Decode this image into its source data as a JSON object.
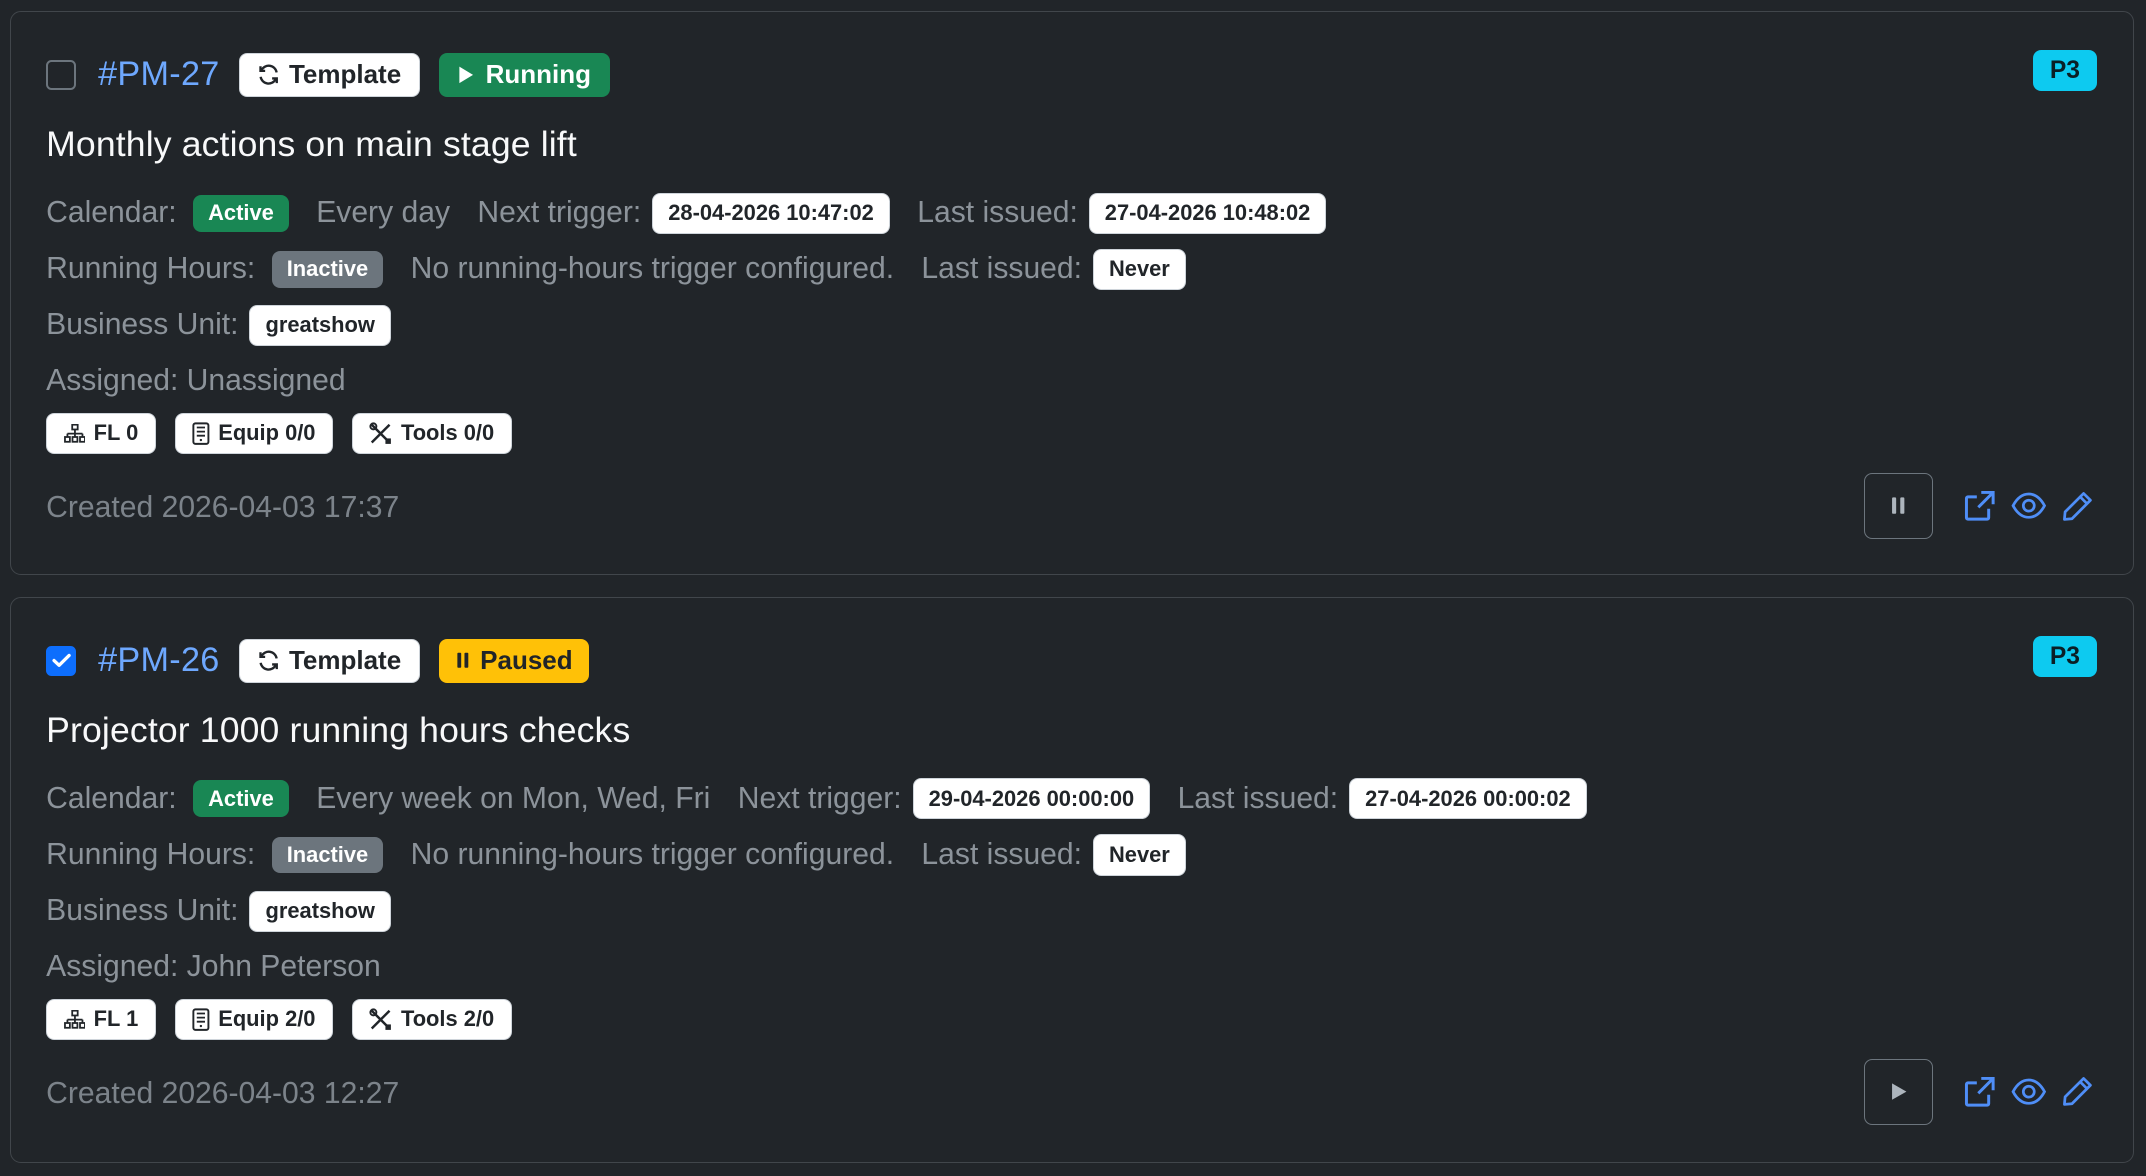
{
  "cards": [
    {
      "id": "#PM-27",
      "checked": false,
      "template_label": "Template",
      "status": "Running",
      "priority": "P3",
      "title": "Monthly actions on main stage lift",
      "calendar_label": "Calendar:",
      "calendar_state": "Active",
      "schedule": "Every day",
      "next_trigger_label": "Next trigger:",
      "next_trigger": "28-04-2026 10:47:02",
      "last_issued_label": "Last issued:",
      "last_issued": "27-04-2026 10:48:02",
      "running_hours_label": "Running Hours:",
      "running_hours_state": "Inactive",
      "running_hours_note": "No running-hours trigger configured.",
      "rh_last_issued_label": "Last issued:",
      "rh_last_issued": "Never",
      "business_unit_label": "Business Unit:",
      "business_unit": "greatshow",
      "assigned": "Assigned: Unassigned",
      "chip_fl": "FL 0",
      "chip_equip": "Equip 0/0",
      "chip_tools": "Tools 0/0",
      "created": "Created 2026-04-03 17:37",
      "toggle_icon": "pause-icon"
    },
    {
      "id": "#PM-26",
      "checked": true,
      "template_label": "Template",
      "status": "Paused",
      "priority": "P3",
      "title": "Projector 1000 running hours checks",
      "calendar_label": "Calendar:",
      "calendar_state": "Active",
      "schedule": "Every week on Mon, Wed, Fri",
      "next_trigger_label": "Next trigger:",
      "next_trigger": "29-04-2026 00:00:00",
      "last_issued_label": "Last issued:",
      "last_issued": "27-04-2026 00:00:02",
      "running_hours_label": "Running Hours:",
      "running_hours_state": "Inactive",
      "running_hours_note": "No running-hours trigger configured.",
      "rh_last_issued_label": "Last issued:",
      "rh_last_issued": "Never",
      "business_unit_label": "Business Unit:",
      "business_unit": "greatshow",
      "assigned": "Assigned: John Peterson",
      "chip_fl": "FL 1",
      "chip_equip": "Equip 2/0",
      "chip_tools": "Tools 2/0",
      "created": "Created 2026-04-03 12:27",
      "toggle_icon": "play-icon"
    }
  ],
  "colors": {
    "background": "#212529",
    "link": "#6ea8fe",
    "success": "#198754",
    "warning": "#ffc107",
    "info": "#0dcaf0",
    "secondary": "#6c757d",
    "checkbox_checked": "#0d6efd"
  }
}
